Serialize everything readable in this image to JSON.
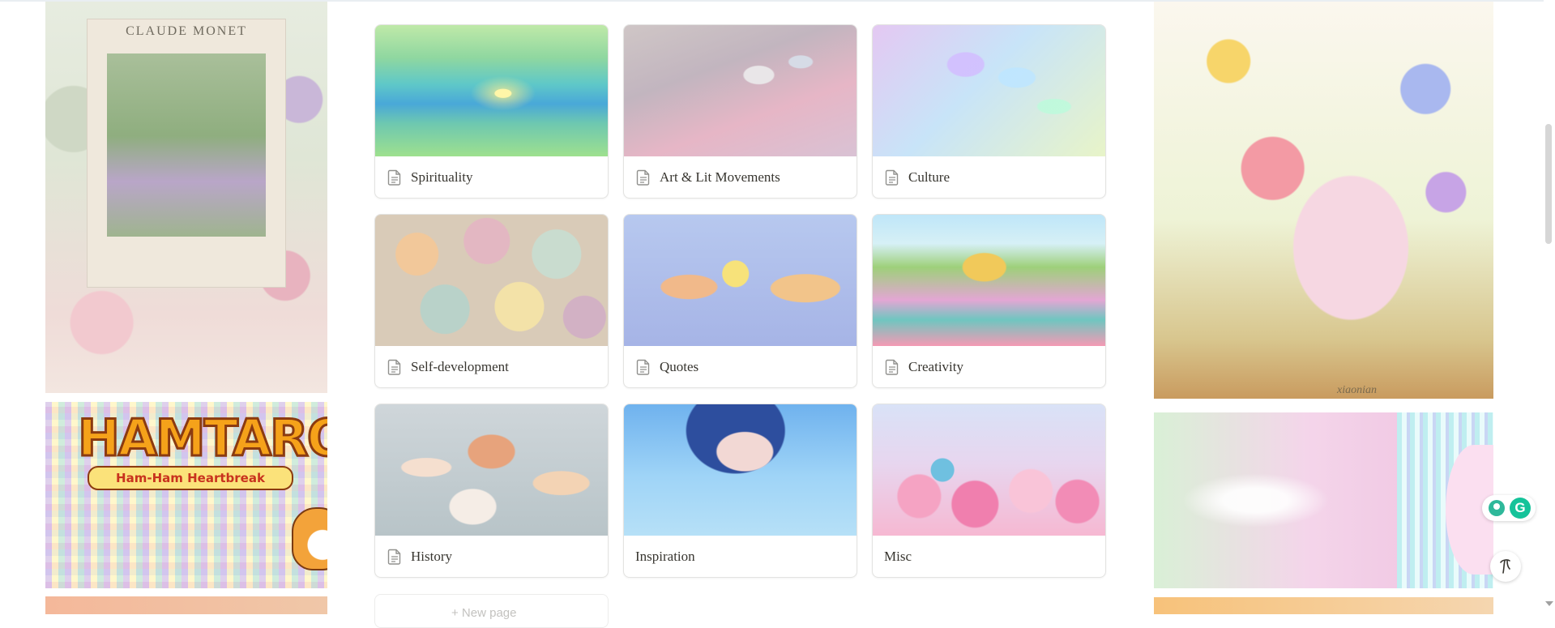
{
  "left_column": {
    "monet_poster": {
      "caption": "CLAUDE MONET"
    },
    "hamtaro_poster": {
      "logo_text": "HAMTARO",
      "subtitle": "Ham-Ham Heartbreak"
    }
  },
  "gallery": {
    "cards": [
      {
        "label": "Spirituality",
        "icon": "page-icon"
      },
      {
        "label": "Art & Lit Movements",
        "icon": "page-icon"
      },
      {
        "label": "Culture",
        "icon": "page-icon"
      },
      {
        "label": "Self-development",
        "icon": "page-icon"
      },
      {
        "label": "Quotes",
        "icon": "page-icon"
      },
      {
        "label": "Creativity",
        "icon": "page-icon"
      },
      {
        "label": "History",
        "icon": "page-icon"
      },
      {
        "label": "Inspiration",
        "icon": null
      },
      {
        "label": "Misc",
        "icon": null
      }
    ],
    "new_page_label": "+ New page"
  },
  "right_column": {
    "flower_art": {
      "signature": "xiaonian"
    }
  },
  "widgets": {
    "grammarly_letter": "G",
    "help_icon": "help-icon"
  },
  "colors": {
    "text": "#37352f",
    "card_border": "#e3e3e1",
    "grammarly": "#15c39a"
  }
}
